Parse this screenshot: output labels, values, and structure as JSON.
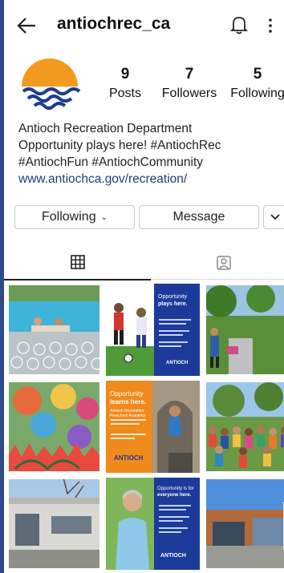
{
  "header": {
    "username": "antiochrec_ca"
  },
  "stats": {
    "posts_count": "9",
    "posts_label": "Posts",
    "followers_count": "7",
    "followers_label": "Followers",
    "following_count": "5",
    "following_label": "Following"
  },
  "bio": {
    "name": "Antioch Recreation Department",
    "line1": "Opportunity plays here! #AntiochRec",
    "line2": "#AntiochFun #AntiochCommunity",
    "link": "www.antiochca.gov/recreation/"
  },
  "buttons": {
    "following_label": "Following",
    "message_label": "Message"
  },
  "posts": {
    "tile2": {
      "heading1": "Opportunity",
      "heading2": "plays here.",
      "brand": "ANTIOCH"
    },
    "tile5": {
      "heading1": "Opportunity",
      "heading2": "learns here.",
      "sub": "Antioch Recreation Preschool Academy",
      "brand": "ANTIOCH"
    },
    "tile8": {
      "heading1": "Opportunity is for",
      "heading2": "everyone here.",
      "brand": "ANTIOCH"
    }
  },
  "colors": {
    "page_border": "#2e4a88",
    "link": "#1d3e74",
    "logo_orange": "#f29a1e",
    "logo_blue": "#1a3d8f",
    "promo_blue": "#1b3a9a",
    "promo_orange": "#f08a1c"
  },
  "icons": [
    "back-arrow-icon",
    "bell-icon",
    "more-vertical-icon",
    "grid-icon",
    "tagged-icon",
    "chevron-down-icon"
  ]
}
